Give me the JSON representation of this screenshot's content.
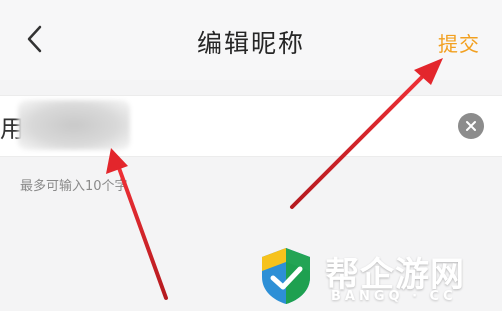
{
  "header": {
    "title": "编辑昵称",
    "submit_label": "提交",
    "back_icon": "chevron-left-icon"
  },
  "nickname": {
    "visible_prefix": "用",
    "hint": "最多可输入10个字",
    "clear_icon": "close-circle-icon"
  },
  "watermark": {
    "title": "帮企游网",
    "subtitle": "BANGQ · CC"
  },
  "colors": {
    "accent": "#f2a020",
    "arrow": "#e3262c",
    "background": "#f4f4f5"
  }
}
